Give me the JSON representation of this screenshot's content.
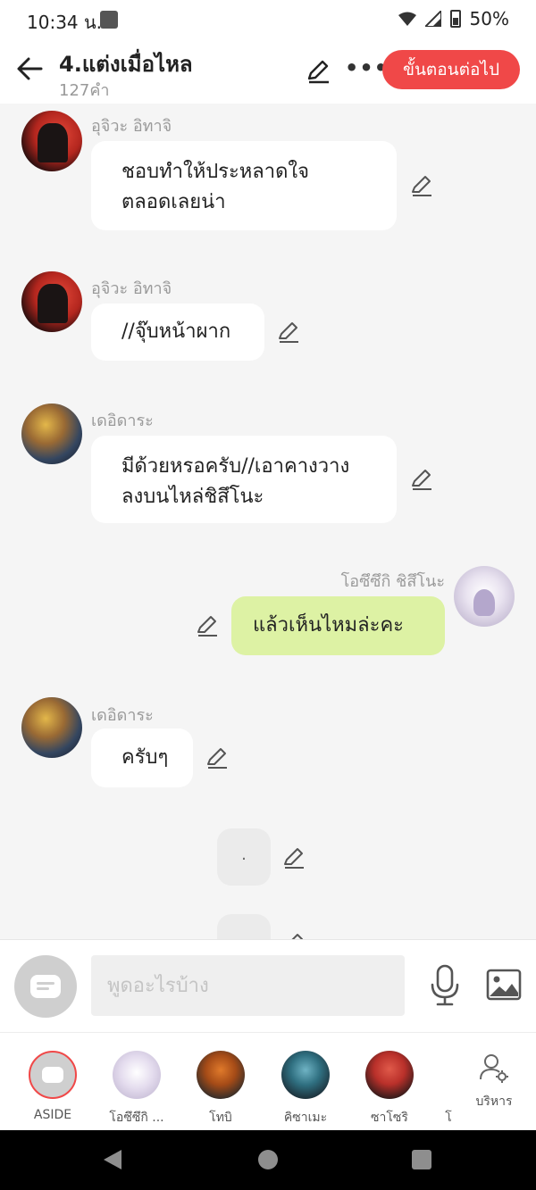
{
  "status_bar": {
    "time": "10:34 น.",
    "battery": "50%"
  },
  "header": {
    "title": "4.แต่งเมื่อไหล",
    "word_count": "127คำ",
    "next_button": "ขั้นตอนต่อไป"
  },
  "messages": [
    {
      "sender": "อุจิวะ อิทาจิ",
      "lines": [
        "ชอบทำให้ประหลาดใจ",
        "ตลอดเลยน่า"
      ]
    },
    {
      "sender": "อุจิวะ อิทาจิ",
      "lines": [
        "//จุ๊บหน้าผาก"
      ]
    },
    {
      "sender": "เดอิดาระ",
      "lines": [
        "มีด้วยหรอครับ//เอาคางวาง",
        "ลงบนไหล่ชิสึโนะ"
      ]
    },
    {
      "sender": "โอซึซึกิ  ชิสึโนะ",
      "lines": [
        "แล้วเห็นไหมล่ะคะ"
      ]
    },
    {
      "sender": "เดอิดาระ",
      "lines": [
        "ครับๆ"
      ]
    },
    {
      "sender": "",
      "lines": [
        "."
      ]
    }
  ],
  "composer": {
    "placeholder": "พูดอะไรบ้าง"
  },
  "characters": [
    {
      "label": "ASIDE"
    },
    {
      "label": "โอซึซึกิ ..."
    },
    {
      "label": "โทบิ"
    },
    {
      "label": "คิซาเมะ"
    },
    {
      "label": "ซาโซริ"
    },
    {
      "label": "โ"
    }
  ],
  "manage_label": "บริหาร",
  "colors": {
    "accent": "#f04848",
    "my_bubble": "#ddf2a4"
  }
}
